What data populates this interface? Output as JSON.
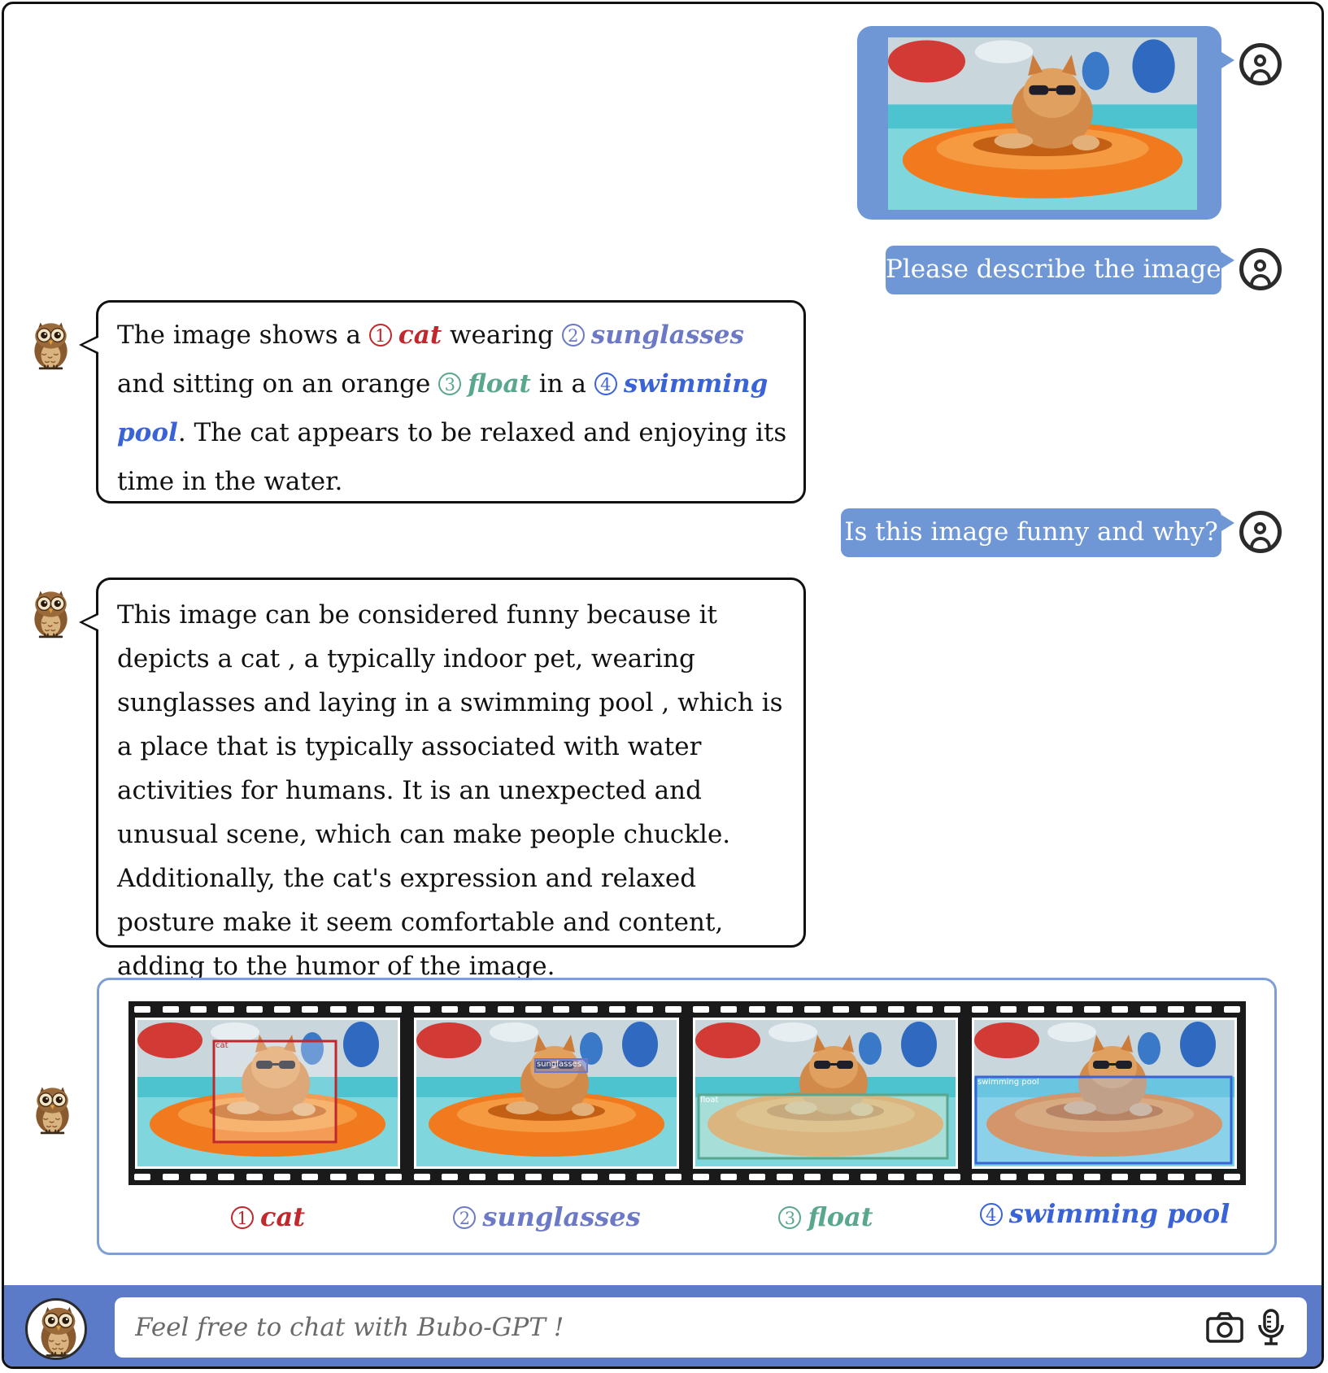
{
  "conversation": {
    "user_message_1": "Please describe the image.",
    "bot_reply_1": {
      "p1": "The image shows a",
      "p2": "wearing",
      "p3": "and",
      "p4": "sitting on an orange",
      "p5": "in a",
      "p6": ".",
      "p7": "The cat appears to be relaxed and enjoying its time in the water."
    },
    "user_message_2": "Is this image funny and why?",
    "bot_reply_2": "This image can be considered funny because it depicts a cat , a typically indoor pet, wearing sunglasses and laying in a swimming pool , which is a place that is typically associated with water activities for humans. It is an unexpected and unusual scene, which can make people chuckle. Additionally, the cat's expression and relaxed posture make it seem comfortable and content, adding to the humor of the image."
  },
  "tags": [
    {
      "num": "1",
      "label": "cat",
      "color": "#c0282d"
    },
    {
      "num": "2",
      "label": "sunglasses",
      "color": "#6c79c6"
    },
    {
      "num": "3",
      "label": "float",
      "color": "#5aa78f"
    },
    {
      "num": "4",
      "label": "swimming pool",
      "color": "#3b63d8"
    }
  ],
  "filmstrip": {
    "box_labels": [
      "cat",
      "sunglasses",
      "float",
      "swimming pool"
    ]
  },
  "input": {
    "placeholder": "Feel free to chat with Bubo-GPT !"
  },
  "icons": {
    "user_avatar": "user-circle-icon",
    "bot_avatar": "owl-icon",
    "camera": "camera-icon",
    "microphone": "microphone-icon"
  },
  "colors": {
    "user_bubble": "#6f97d6",
    "input_bar": "#5b7ac7",
    "panel_border": "#7d9fd6"
  }
}
